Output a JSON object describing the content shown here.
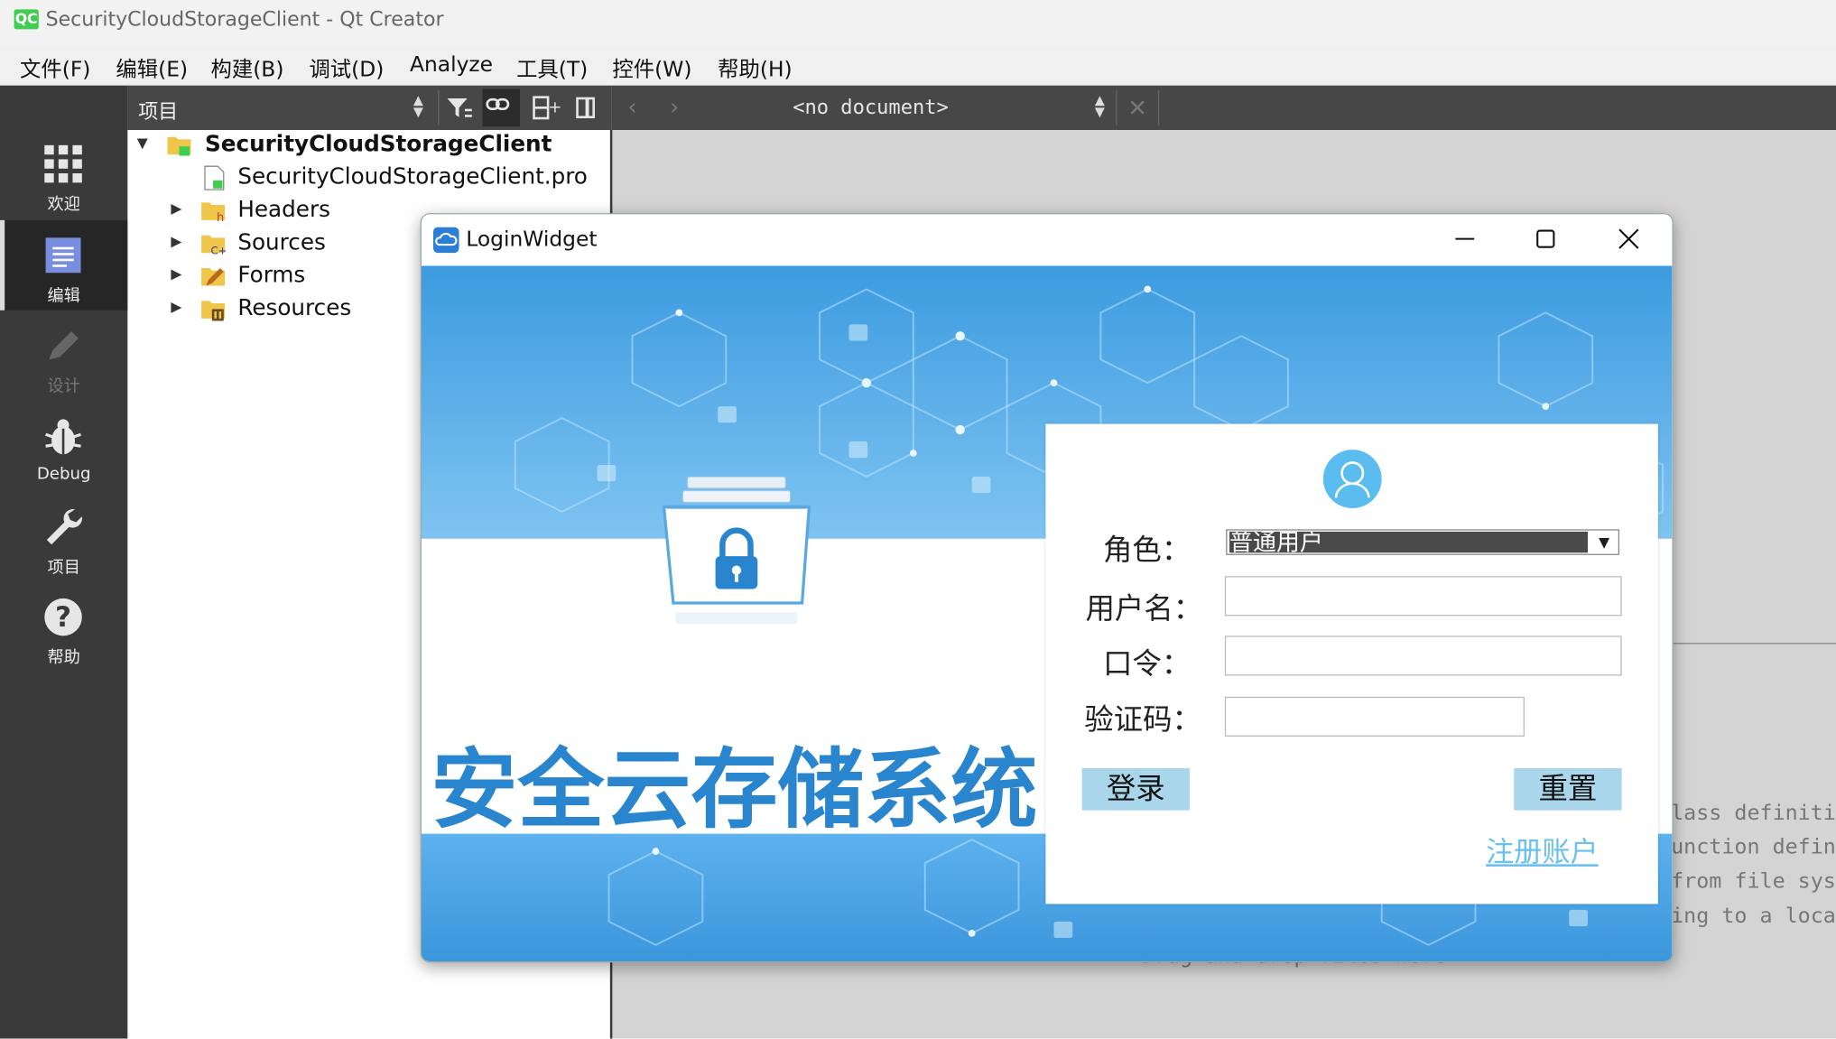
{
  "window": {
    "app_icon": "QC",
    "title": "SecurityCloudStorageClient - Qt Creator"
  },
  "menubar": {
    "items": [
      "文件(F)",
      "编辑(E)",
      "构建(B)",
      "调试(D)",
      "Analyze",
      "工具(T)",
      "控件(W)",
      "帮助(H)"
    ]
  },
  "sidebar": {
    "modes": [
      {
        "label": "欢迎",
        "icon": "grid-icon"
      },
      {
        "label": "编辑",
        "icon": "edit-document-icon"
      },
      {
        "label": "设计",
        "icon": "pencil-icon"
      },
      {
        "label": "Debug",
        "icon": "bug-icon"
      },
      {
        "label": "项目",
        "icon": "wrench-icon"
      },
      {
        "label": "帮助",
        "icon": "help-icon"
      }
    ]
  },
  "project_panel": {
    "title": "项目",
    "tree": [
      {
        "label": "SecurityCloudStorageClient",
        "level": 0,
        "expanded": true,
        "bold": true,
        "icon": "project-folder-icon"
      },
      {
        "label": "SecurityCloudStorageClient.pro",
        "level": 1,
        "icon": "pro-file-icon"
      },
      {
        "label": "Headers",
        "level": 1,
        "expanded": false,
        "icon": "headers-folder-icon"
      },
      {
        "label": "Sources",
        "level": 1,
        "expanded": false,
        "icon": "sources-folder-icon"
      },
      {
        "label": "Forms",
        "level": 1,
        "expanded": false,
        "icon": "forms-folder-icon"
      },
      {
        "label": "Resources",
        "level": 1,
        "expanded": false,
        "icon": "resources-folder-icon"
      }
    ]
  },
  "editor": {
    "document_combo": "<no document>",
    "hints": [
      "lass definiti",
      "unction defin",
      "from file sys",
      "ing to a loca",
      "Drag and drop files here"
    ]
  },
  "login_dialog": {
    "title": "LoginWidget",
    "app_name": "安全云存储系统",
    "role_label": "角色：",
    "role_value": "普通用户",
    "username_label": "用户名：",
    "password_label": "口令：",
    "captcha_label": "验证码：",
    "login_button": "登录",
    "reset_button": "重置",
    "register_link": "注册账户"
  },
  "colors": {
    "accent_blue": "#2a85cf",
    "banner_blue": "#4aa8e6",
    "button_blue": "#a9d6ea",
    "link_blue": "#6ac0ee",
    "sidebar_dark": "#3a3a3a"
  }
}
